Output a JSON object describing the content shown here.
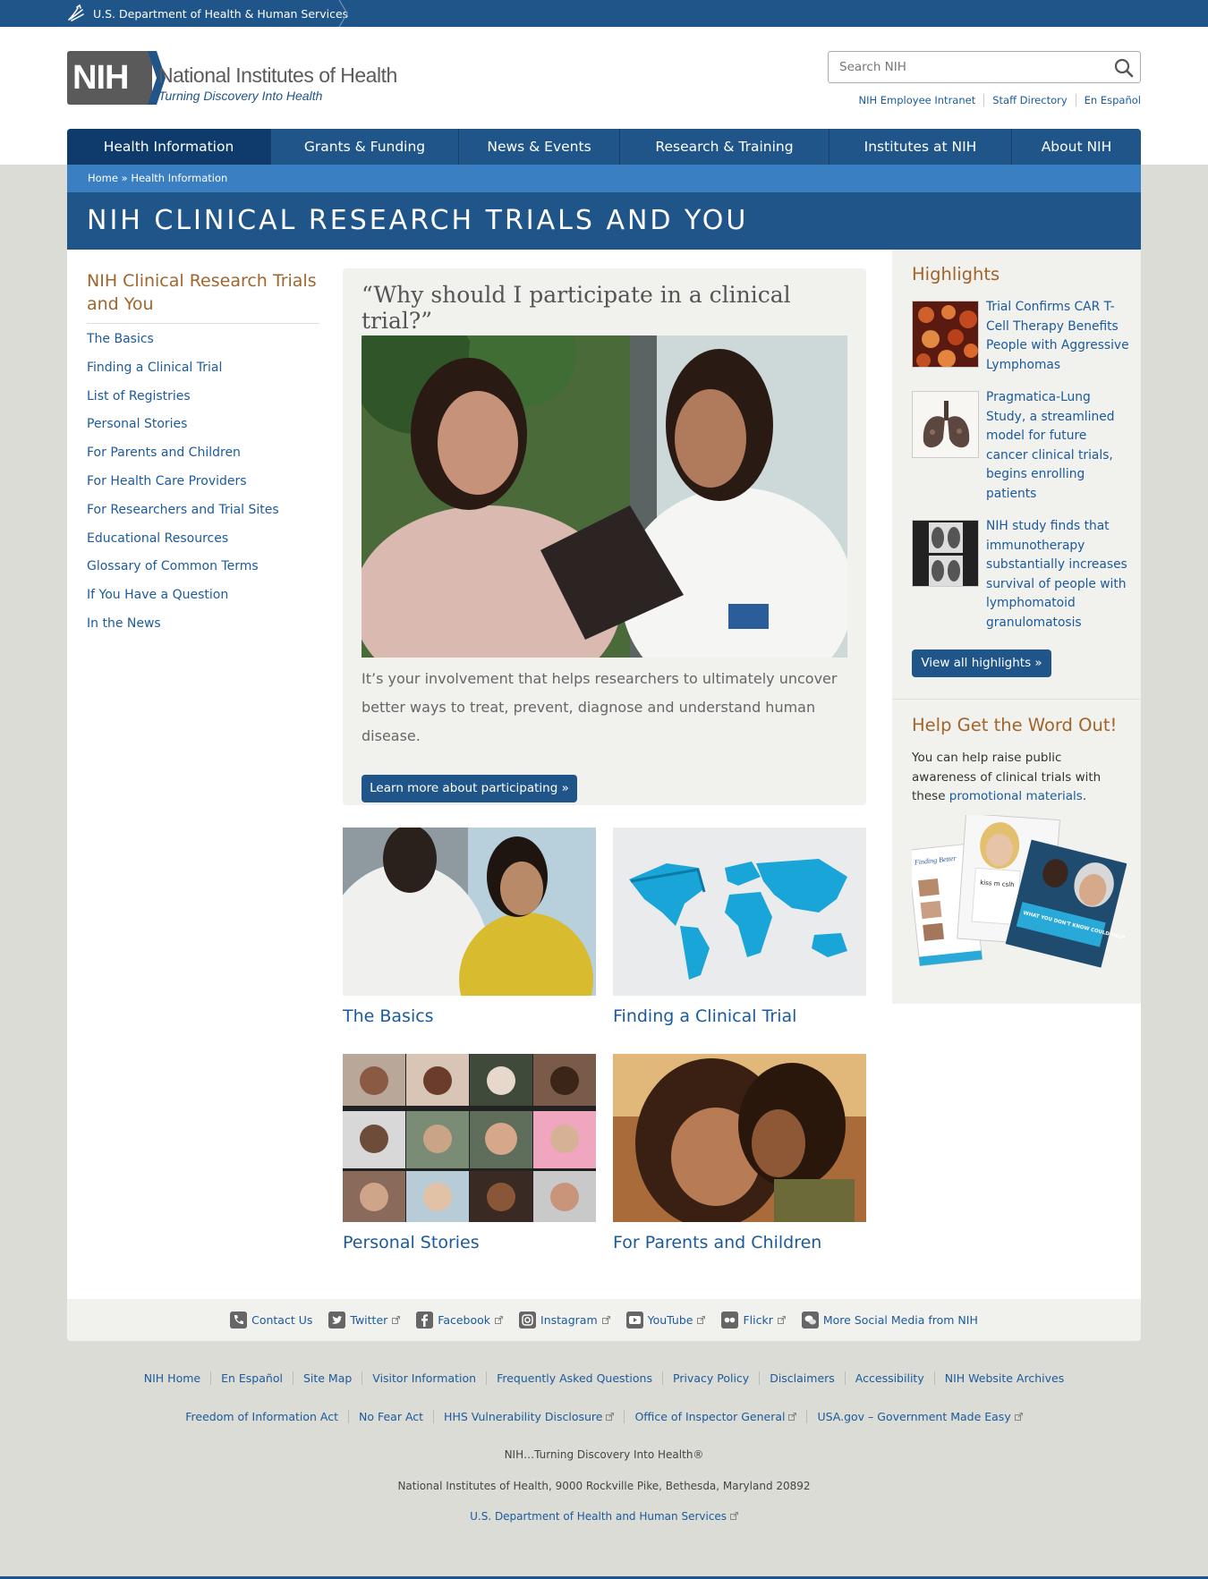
{
  "hhs_bar": {
    "label": "U.S. Department of Health & Human Services"
  },
  "header": {
    "logo_abbr": "NIH",
    "logo_title": "National Institutes of Health",
    "logo_tagline": "Turning Discovery Into Health",
    "search_placeholder": "Search NIH",
    "utility_links": [
      "NIH Employee Intranet",
      "Staff Directory",
      "En Español"
    ]
  },
  "nav": {
    "items": [
      "Health Information",
      "Grants & Funding",
      "News & Events",
      "Research & Training",
      "Institutes at NIH",
      "About NIH"
    ],
    "active": "Health Information"
  },
  "breadcrumb": {
    "home": "Home",
    "separator": " » ",
    "current": "Health Information"
  },
  "page_title": "NIH CLINICAL RESEARCH TRIALS AND YOU",
  "sidebar": {
    "title": "NIH Clinical Research Trials and You",
    "items": [
      "The Basics",
      "Finding a Clinical Trial",
      "List of Registries",
      "Personal Stories",
      "For Parents and Children",
      "For Health Care Providers",
      "For Researchers and Trial Sites",
      "Educational Resources",
      "Glossary of Common Terms",
      "If You Have a Question",
      "In the News"
    ]
  },
  "feature": {
    "question": "“Why should I participate in a clinical trial?”",
    "text": "It’s your involvement that helps researchers to ultimately uncover better ways to treat, prevent, diagnose and understand human disease.",
    "button": "Learn more about participating »"
  },
  "tiles": [
    "The Basics",
    "Finding a Clinical Trial",
    "Personal Stories",
    "For Parents and Children"
  ],
  "highlights": {
    "title": "Highlights",
    "items": [
      "Trial Confirms CAR T-Cell Therapy Benefits People with Aggressive Lymphomas",
      "Pragmatica-Lung Study, a streamlined model for future cancer clinical trials, begins enrolling patients",
      "NIH study finds that immunotherapy substantially increases survival of people with lymphomatoid granulomatosis"
    ],
    "button": "View all highlights »"
  },
  "word_out": {
    "title": "Help Get the Word Out!",
    "text": "You can help raise public awareness of clinical trials with these ",
    "link": "promotional materials",
    "text_end": ".",
    "poster_caption": "WHAT YOU DON'T KNOW COULD HELP YOU.",
    "poster_shirt": "kiss m cslh",
    "poster_header": "Finding Better"
  },
  "social": [
    "Contact Us",
    "Twitter",
    "Facebook",
    "Instagram",
    "YouTube",
    "Flickr",
    "More Social Media from NIH"
  ],
  "footer": {
    "row1": [
      "NIH Home",
      "En Español",
      "Site Map",
      "Visitor Information",
      "Frequently Asked Questions",
      "Privacy Policy",
      "Disclaimers",
      "Accessibility",
      "NIH Website Archives"
    ],
    "row2": [
      "Freedom of Information Act",
      "No Fear Act",
      "HHS Vulnerability Disclosure",
      "Office of Inspector General",
      "USA.gov – Government Made Easy"
    ],
    "tagline": "NIH…Turning Discovery Into Health®",
    "address": "National Institutes of Health, 9000 Rockville Pike, Bethesda, Maryland 20892",
    "hhs_link": "U.S. Department of Health and Human Services"
  },
  "colors": {
    "primary": "#20558a",
    "dark_nav": "#0e3b6b",
    "breadcrumb": "#3b7fc3",
    "heading_accent": "#a0652d",
    "link": "#1b5a9c"
  }
}
